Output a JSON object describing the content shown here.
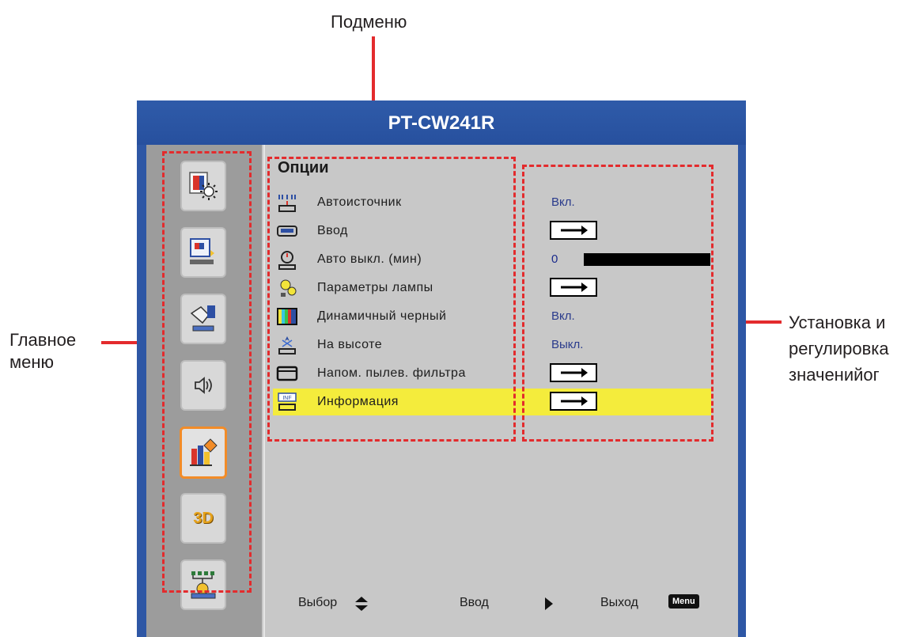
{
  "callouts": {
    "submenu": "Подменю",
    "main_menu": [
      "Главное",
      "меню"
    ],
    "settings": [
      "Установка и",
      "регулировка",
      "значенийог"
    ]
  },
  "osd": {
    "title": "PT-CW241R",
    "submenu_title": "Опции",
    "sidebar_icons": [
      "image-icon",
      "display-icon",
      "settings-hand-icon",
      "audio-icon",
      "options-icon",
      "3d-icon",
      "network-icon"
    ],
    "sidebar_3d_label": "3D",
    "active_sidebar_index": 4,
    "items": [
      {
        "label": "Автоисточник",
        "value": "Вкл.",
        "type": "text"
      },
      {
        "label": "Ввод",
        "value": "",
        "type": "arrow"
      },
      {
        "label": "Авто выкл. (мин)",
        "value": "0",
        "type": "slider",
        "level": 0
      },
      {
        "label": "Параметры лампы",
        "value": "",
        "type": "arrow"
      },
      {
        "label": "Динамичный черный",
        "value": "Вкл.",
        "type": "text"
      },
      {
        "label": "На высоте",
        "value": "Выкл.",
        "type": "text"
      },
      {
        "label": "Напом. пылев. фильтра",
        "value": "",
        "type": "arrow"
      },
      {
        "label": "Информация",
        "value": "",
        "type": "arrow",
        "highlighted": true
      }
    ],
    "footer": {
      "select_label": "Выбор",
      "enter_label": "Ввод",
      "exit_label": "Выход",
      "menu_badge": "Menu"
    }
  },
  "colors": {
    "accent": "#e32b2d",
    "highlight": "#f4ec3c",
    "osd_frame": "#2e57a5",
    "active_border": "#f28c28"
  }
}
